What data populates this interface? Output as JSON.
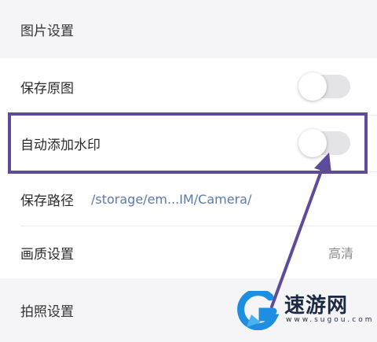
{
  "sections": {
    "picture_settings": "图片设置",
    "photo_settings": "拍照设置"
  },
  "rows": {
    "save_original": {
      "label": "保存原图",
      "toggle_on": false
    },
    "auto_watermark": {
      "label": "自动添加水印",
      "toggle_on": false
    },
    "save_path": {
      "label": "保存路径",
      "value": "/storage/em...IM/Camera/"
    },
    "quality": {
      "label": "画质设置",
      "value": "高清"
    }
  },
  "annotation": {
    "highlight_color": "#5e4b9a"
  },
  "watermark": {
    "brand": "速游网",
    "url": "www.sugou.com"
  }
}
